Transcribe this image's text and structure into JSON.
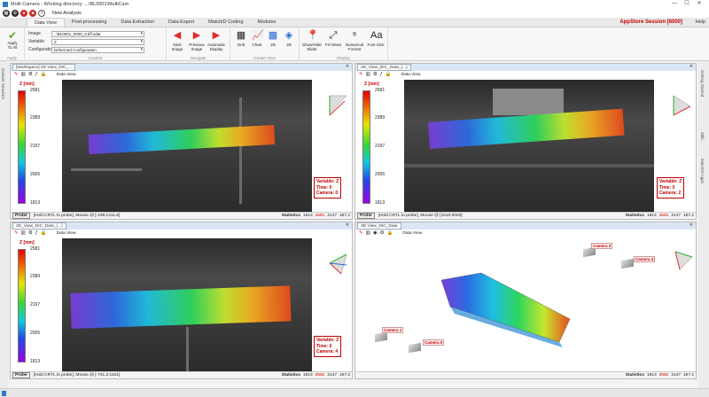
{
  "window": {
    "title": "Multi Camera - Working directory: ...\\BL0001\\MultiCam",
    "controls": [
      "—",
      "☐",
      "✕"
    ]
  },
  "qa": {
    "new_analysis": "New Analysis"
  },
  "tabs": [
    "Data View",
    "Post-processing",
    "Data Extraction",
    "Data Export",
    "MatchID Coding",
    "Modules"
  ],
  "session": "AppStore Session [8000]",
  "help": "Help",
  "ribbon": {
    "apply": "Apply To All",
    "apply_group": "Apply",
    "image_label": "Image",
    "image_value": "..\\BL0001_0000_0.tiff.sdat",
    "variable_label": "Variable",
    "variable_value": "Z",
    "config_label": "Configuration",
    "config_value": "Deformed Configuration",
    "content_group": "Content",
    "next": "Next Image",
    "previous": "Previous Image",
    "auto": "Automatic Display",
    "navigate_group": "Navigate",
    "grid": "Grid",
    "chart": "Chart",
    "v2d": "2D",
    "v3d": "3D",
    "create_group": "Create View",
    "showhide": "Show/Hide Slider",
    "fit": "Fit Views",
    "numfmt": "Numerical Format",
    "font": "Font Size",
    "display_group": "Display"
  },
  "left_strip": "Dataset Structure",
  "right_strip": [
    "Getting Started",
    "Wiki",
    "MatchID Apps"
  ],
  "panes": [
    {
      "tab": "[Workspace] 2D View_DIC_...",
      "dataview": "Data View",
      "ztitle": "Z [mm]",
      "ticks": [
        "2581",
        "2389",
        "2197",
        "2005",
        "1813"
      ],
      "info": [
        "Variable: Z",
        "Time: 0",
        "Camera: 0"
      ],
      "probe": "Probe",
      "probe_text": "[Hold CRTL to probe], Mouse @ [-239;1211.8]",
      "stats_label": "Statistics",
      "stats": [
        "1813",
        "2581",
        "2147",
        "167.2"
      ]
    },
    {
      "tab": "2D_View_DIC_Data_(...)",
      "dataview": "Data View",
      "ztitle": "Z [mm]",
      "ticks": [
        "2581",
        "2389",
        "2197",
        "2005",
        "1813"
      ],
      "info": [
        "Variable: Z",
        "Time: 0",
        "Camera: 2"
      ],
      "probe": "Probe",
      "probe_text": "[Hold CRTL to probe], Mouse @ [1510;0003]",
      "stats_label": "Statistics",
      "stats": [
        "1813",
        "2581",
        "2147",
        "167.2"
      ]
    },
    {
      "tab": "2D_View_DIC_Data_(...)",
      "dataview": "Data View",
      "ztitle": "Z [mm]",
      "ticks": [
        "2581",
        "2389",
        "2197",
        "2005",
        "1813"
      ],
      "info": [
        "Variable: Z",
        "Time: 0",
        "Camera: 4"
      ],
      "probe": "Probe",
      "probe_text": "[Hold CRTL to probe], Mouse @ [-741.2;1101]",
      "stats_label": "Statistics",
      "stats": [
        "1813",
        "2581",
        "2147",
        "167.2"
      ]
    },
    {
      "tab": "3D View_DIC_Data",
      "dataview": "Data View",
      "cams": [
        "Camera 1",
        "Camera 0",
        "Camera 3",
        "Camera 4"
      ],
      "stats_label": "Statistics",
      "stats": [
        "1813",
        "2581",
        "2147",
        "167.2"
      ]
    }
  ]
}
